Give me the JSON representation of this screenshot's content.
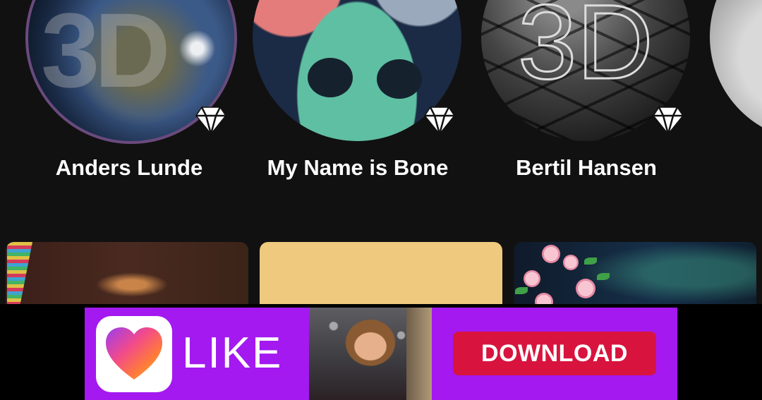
{
  "artists": [
    {
      "name": "Anders Lunde",
      "avatar_text": "3D",
      "badge_icon": "diamond-icon"
    },
    {
      "name": "My Name is Bone",
      "badge_icon": "diamond-icon"
    },
    {
      "name": "Bertil Hansen",
      "avatar_text": "3D",
      "badge_icon": "diamond-icon"
    }
  ],
  "wallpapers": [
    {
      "accent": "#3a1e18"
    },
    {
      "accent": "#efc97e"
    },
    {
      "accent": "#16304a"
    }
  ],
  "ad": {
    "brand": "LIKE",
    "cta": "DOWNLOAD",
    "background": "#a319f0",
    "cta_color": "#d8143e",
    "logo_icon": "heart-icon"
  }
}
